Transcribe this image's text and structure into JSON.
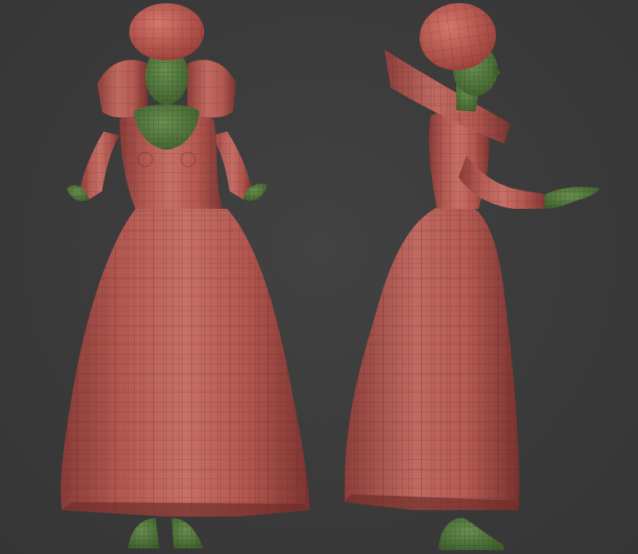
{
  "viewport": {
    "background_color": "#3b3b3b"
  },
  "models": [
    {
      "view": "front",
      "material_colors": {
        "cloth": "#b5554f",
        "skin": "#4f7a3a",
        "wire": "#2a1412"
      }
    },
    {
      "view": "side",
      "material_colors": {
        "cloth": "#b5554f",
        "skin": "#4f7a3a",
        "wire": "#2a1412"
      }
    }
  ]
}
